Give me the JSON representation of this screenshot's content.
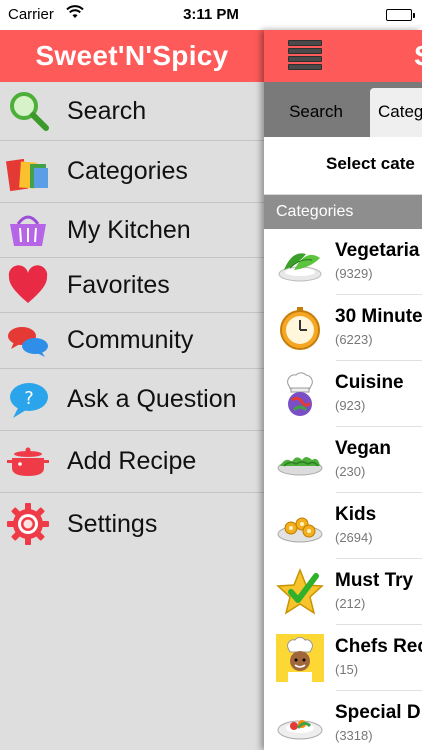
{
  "status_bar": {
    "carrier": "Carrier",
    "time": "3:11 PM"
  },
  "sidebar": {
    "title": "Sweet'N'Spicy",
    "items": [
      {
        "label": "Search",
        "icon": "magnifier-icon"
      },
      {
        "label": "Categories",
        "icon": "categories-icon"
      },
      {
        "label": "My Kitchen",
        "icon": "basket-icon"
      },
      {
        "label": "Favorites",
        "icon": "heart-icon"
      },
      {
        "label": "Community",
        "icon": "chat-bubbles-icon"
      },
      {
        "label": "Ask a Question",
        "icon": "question-bubble-icon"
      },
      {
        "label": "Add Recipe",
        "icon": "cooking-pot-icon"
      },
      {
        "label": "Settings",
        "icon": "gear-icon"
      }
    ]
  },
  "main": {
    "title_fragment": "S",
    "tabs": [
      {
        "label": "Search",
        "selected": false
      },
      {
        "label": "Categ",
        "selected": true
      }
    ],
    "select_label": "Select cate",
    "section_header": "Categories",
    "categories": [
      {
        "name": "Vegetaria",
        "count": "(9329)",
        "icon": "vegetarian-salad-icon"
      },
      {
        "name": "30 Minute",
        "count": "(6223)",
        "icon": "clock-icon"
      },
      {
        "name": "Cuisine",
        "count": "(923)",
        "icon": "chef-hat-globe-icon"
      },
      {
        "name": "Vegan",
        "count": "(230)",
        "icon": "vegan-greens-icon"
      },
      {
        "name": "Kids",
        "count": "(2694)",
        "icon": "kids-snacks-icon"
      },
      {
        "name": "Must Try",
        "count": "(212)",
        "icon": "star-check-icon"
      },
      {
        "name": "Chefs Rec",
        "count": "(15)",
        "icon": "chef-icon"
      },
      {
        "name": "Special D",
        "count": "(3318)",
        "icon": "special-dish-icon"
      }
    ]
  },
  "colors": {
    "brand_red": "#ff5a5a",
    "sidebar_bg": "#dedede",
    "tab_bar_bg": "#7a7a7a",
    "section_header_bg": "#8e8e8e"
  }
}
